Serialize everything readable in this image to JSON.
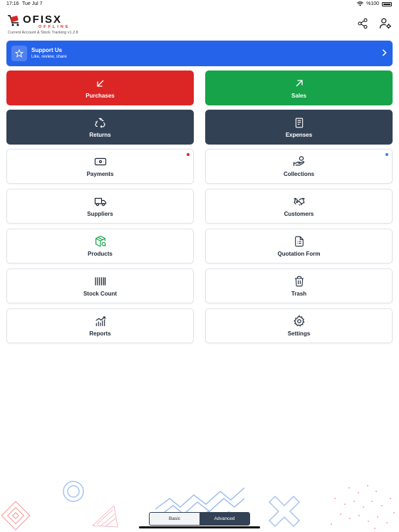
{
  "status_bar": {
    "time": "17:16",
    "date": "Tue Jul 7",
    "battery": "%100"
  },
  "app": {
    "name": "OFISX",
    "tagline": "OFFLINE",
    "version": "Current Account & Stock Tracking v1.2.8"
  },
  "header": {
    "actions": [
      {
        "icon": "share-icon"
      },
      {
        "icon": "user-settings-icon"
      }
    ]
  },
  "support": {
    "title": "Support Us",
    "subtitle": "Like, review, share",
    "icon": "star-icon"
  },
  "tiles": [
    {
      "label": "Purchases",
      "icon": "arrow-down-left-icon",
      "style": "red"
    },
    {
      "label": "Sales",
      "icon": "arrow-up-right-icon",
      "style": "green"
    },
    {
      "label": "Returns",
      "icon": "recycle-icon",
      "style": "dark"
    },
    {
      "label": "Expenses",
      "icon": "receipt-icon",
      "style": "dark"
    },
    {
      "label": "Payments",
      "icon": "banknote-icon",
      "style": "white",
      "dot": "#dc2626"
    },
    {
      "label": "Collections",
      "icon": "hand-coins-icon",
      "style": "white",
      "dot": "#3b82f6"
    },
    {
      "label": "Suppliers",
      "icon": "truck-icon",
      "style": "white"
    },
    {
      "label": "Customers",
      "icon": "handshake-icon",
      "style": "white"
    },
    {
      "label": "Products",
      "icon": "package-search-icon",
      "style": "white"
    },
    {
      "label": "Quotation Form",
      "icon": "document-list-icon",
      "style": "white"
    },
    {
      "label": "Stock Count",
      "icon": "barcode-icon",
      "style": "white"
    },
    {
      "label": "Trash",
      "icon": "trash-icon",
      "style": "white"
    },
    {
      "label": "Reports",
      "icon": "chart-icon",
      "style": "white"
    },
    {
      "label": "Settings",
      "icon": "gear-icon",
      "style": "white"
    }
  ],
  "mode_switch": {
    "options": [
      "Basic",
      "Advanced"
    ],
    "selected": "Advanced"
  },
  "colors": {
    "red": "#dc2626",
    "green": "#16a34a",
    "dark": "#334155",
    "blue": "#2563eb"
  }
}
